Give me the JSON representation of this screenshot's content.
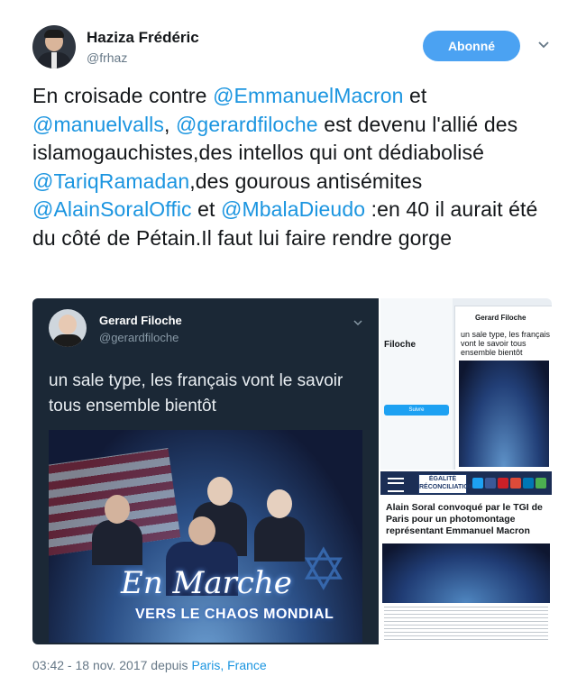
{
  "author": {
    "name": "Haziza Frédéric",
    "handle": "@frhaz"
  },
  "follow_button": {
    "label": "Abonné"
  },
  "tweet": {
    "parts": [
      {
        "t": "En croisade contre ",
        "m": false
      },
      {
        "t": "@EmmanuelMacron",
        "m": true
      },
      {
        "t": " et ",
        "m": false
      },
      {
        "t": "@manuelvalls",
        "m": true
      },
      {
        "t": ", ",
        "m": false
      },
      {
        "t": "@gerardfiloche",
        "m": true
      },
      {
        "t": " est devenu l'allié des islamogauchistes,des intellos qui ont dédiabolisé ",
        "m": false
      },
      {
        "t": "@TariqRamadan",
        "m": true
      },
      {
        "t": ",des gourous antisémites ",
        "m": false
      },
      {
        "t": "@AlainSoralOffic",
        "m": true
      },
      {
        "t": " et ",
        "m": false
      },
      {
        "t": "@MbalaDieudo",
        "m": true
      },
      {
        "t": " :en 40 il aurait été du côté de Pétain.Il faut lui faire rendre gorge",
        "m": false
      }
    ]
  },
  "embedded_screenshot": {
    "name": "Gerard Filoche",
    "handle": "@gerardfiloche",
    "text": "un sale type, les français vont le savoir tous ensemble bientôt",
    "meme_caption_1": "En Marche",
    "meme_caption_2": "VERS LE CHAOS MONDIAL"
  },
  "right_top": {
    "profile_name": "Filoche",
    "mini_name": "Gerard Filoche",
    "mini_text": "un sale type, les français vont le savoir tous ensemble bientôt",
    "follow_bar": "Suivre"
  },
  "right_bottom": {
    "logo": "ÉGALITÉ RÉCONCILIATION",
    "headline": "Alain Soral convoqué par le TGI de Paris pour un photomontage représentant Emmanuel Macron"
  },
  "timestamp": {
    "time": "03:42 - 18 nov. 2017 depuis ",
    "location": "Paris, France"
  },
  "colors": {
    "mention": "#1b95e0",
    "follow_bg": "#4ba2f2",
    "dark_card": "#1b2836"
  }
}
